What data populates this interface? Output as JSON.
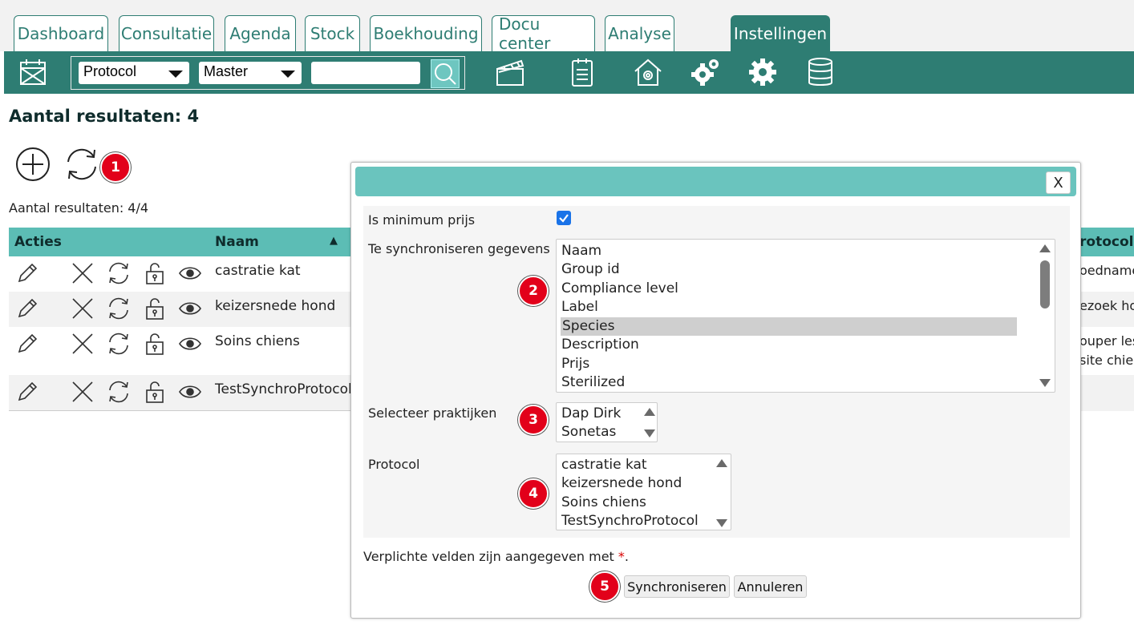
{
  "tabs": [
    {
      "label": "Dashboard"
    },
    {
      "label": "Consultatie"
    },
    {
      "label": "Agenda"
    },
    {
      "label": "Stock"
    },
    {
      "label": "Boekhouding"
    },
    {
      "label": "Docu center"
    },
    {
      "label": "Analyse"
    },
    {
      "label": "Instellingen",
      "active": true
    }
  ],
  "toolbar": {
    "type_select": "Protocol",
    "mode_select": "Master",
    "search_value": "",
    "icons": [
      "calendar-icon",
      "search-icon",
      "clapperboard-icon",
      "clipboard-icon",
      "house-gear-icon",
      "gears-icon",
      "gear-icon",
      "database-icon"
    ]
  },
  "results": {
    "heading": "Aantal resultaten: 4",
    "subcount": "Aantal resultaten: 4/4"
  },
  "table": {
    "columns": {
      "actions": "Acties",
      "name": "Naam",
      "right": "rotocol h"
    },
    "rows": [
      {
        "name": "castratie kat",
        "right": "oedname"
      },
      {
        "name": "keizersnede hond",
        "right": "ezoek ho"
      },
      {
        "name": "Soins chiens",
        "right": "ouper les",
        "right2": "site chien"
      },
      {
        "name": "TestSynchroProtocol",
        "right": ""
      }
    ]
  },
  "badges": [
    "1",
    "2",
    "3",
    "4",
    "5"
  ],
  "dialog": {
    "close_label": "X",
    "min_price_label": "Is minimum prijs",
    "min_price_checked": true,
    "sync_data_label": "Te synchroniseren gegevens",
    "sync_data_options": [
      "Naam",
      "Group id",
      "Compliance level",
      "Label",
      "Species",
      "Description",
      "Prijs",
      "Sterilized"
    ],
    "sync_data_selected": "Species",
    "practices_label": "Selecteer praktijken",
    "practices_options": [
      "Dap Dirk",
      "Sonetas"
    ],
    "protocol_label": "Protocol",
    "protocol_options": [
      "castratie kat",
      "keizersnede hond",
      "Soins chiens",
      "TestSynchroProtocol"
    ],
    "required_note": "Verplichte velden zijn aangegeven met",
    "required_star": "*",
    "required_end": ".",
    "sync_button": "Synchroniseren",
    "cancel_button": "Annuleren"
  },
  "colors": {
    "brand": "#2e7d73",
    "accent": "#6ac4be",
    "badge": "#e2001a",
    "header": "#5cbdb5"
  }
}
